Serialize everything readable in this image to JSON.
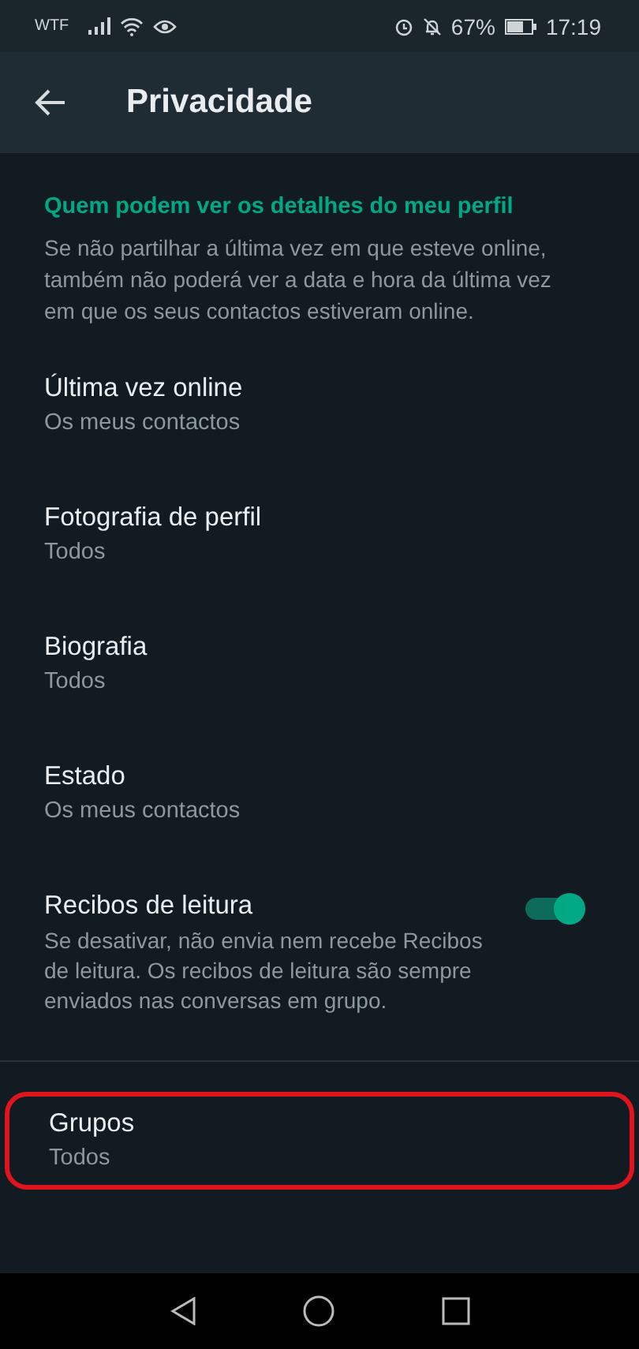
{
  "status_bar": {
    "carrier": "WTF",
    "battery_text": "67%",
    "time": "17:19"
  },
  "app_bar": {
    "title": "Privacidade"
  },
  "section": {
    "header": "Quem podem ver os detalhes do meu perfil",
    "description": "Se não partilhar a última vez em que esteve online, também não poderá ver a data e hora da última vez em que os seus contactos estiveram online.",
    "items": [
      {
        "kind": "option",
        "title": "Última vez online",
        "value": "Os meus contactos"
      },
      {
        "kind": "option",
        "title": "Fotografia de perfil",
        "value": "Todos"
      },
      {
        "kind": "option",
        "title": "Biografia",
        "value": "Todos"
      },
      {
        "kind": "option",
        "title": "Estado",
        "value": "Os meus contactos"
      },
      {
        "kind": "toggle",
        "title": "Recibos de leitura",
        "value": "Se desativar, não envia nem recebe Recibos de leitura. Os recibos de leitura são sempre enviados nas conversas em grupo.",
        "on": true
      }
    ]
  },
  "groups_item": {
    "title": "Grupos",
    "value": "Todos",
    "highlighted": true
  }
}
